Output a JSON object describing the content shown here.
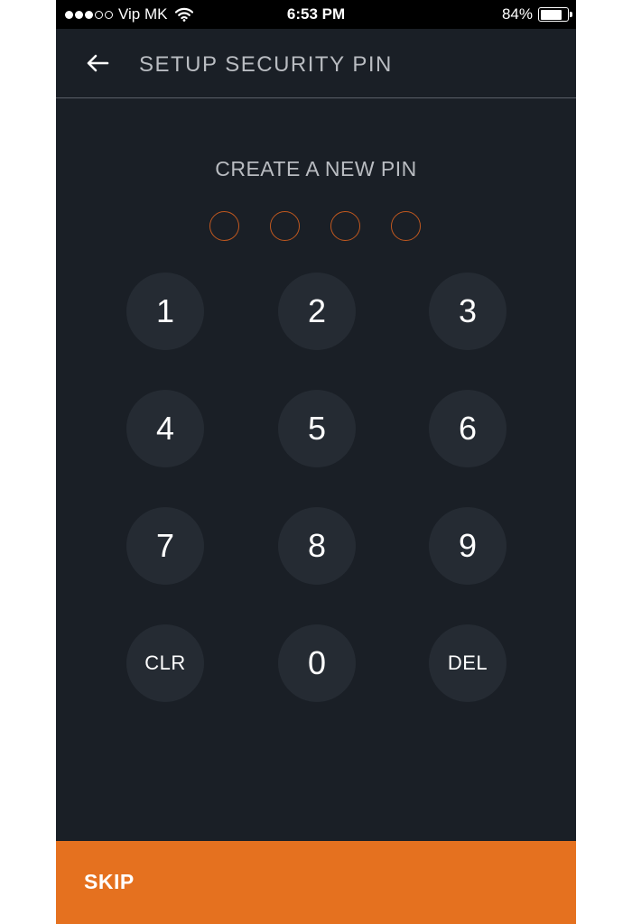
{
  "status_bar": {
    "carrier": "Vip MK",
    "signal_strength": 3,
    "signal_max": 5,
    "time": "6:53 PM",
    "battery_percent_label": "84%",
    "battery_level": 0.84,
    "wifi_icon": "wifi-icon"
  },
  "header": {
    "back_icon": "arrow-left-icon",
    "title": "SETUP SECURITY PIN"
  },
  "pin_entry": {
    "prompt": "CREATE A NEW PIN",
    "length": 4,
    "entered": 0,
    "dot_color": "#c0581f"
  },
  "keypad": {
    "keys": [
      "1",
      "2",
      "3",
      "4",
      "5",
      "6",
      "7",
      "8",
      "9",
      "CLR",
      "0",
      "DEL"
    ]
  },
  "footer": {
    "skip_label": "SKIP",
    "accent_color": "#e5711f"
  },
  "colors": {
    "background": "#1a1f26",
    "key_background": "#252b33",
    "muted_text": "#b9bcc1"
  }
}
